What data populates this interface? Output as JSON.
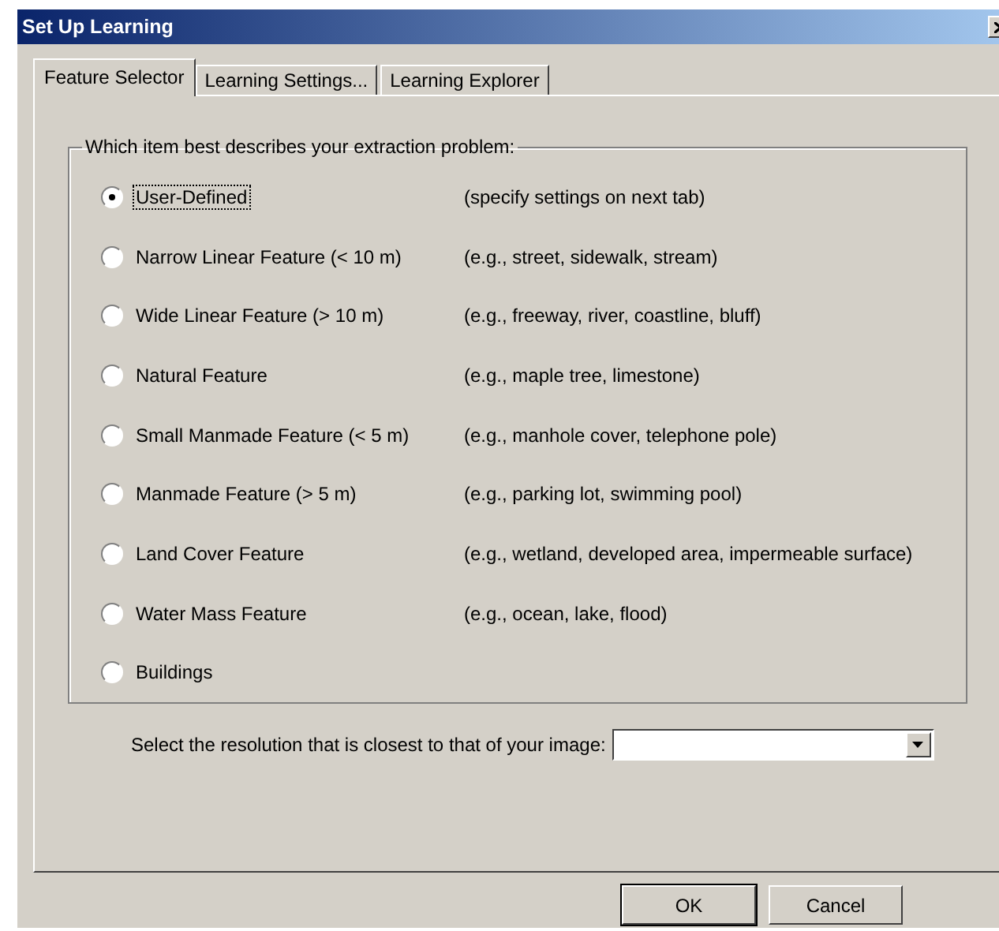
{
  "window": {
    "title": "Set Up Learning"
  },
  "tabs": [
    {
      "label": "Feature Selector",
      "selected": true
    },
    {
      "label": "Learning Settings...",
      "selected": false
    },
    {
      "label": "Learning Explorer",
      "selected": false
    }
  ],
  "group": {
    "legend": "Which item best describes your extraction problem:",
    "options": [
      {
        "label": "User-Defined",
        "hint": "(specify settings on next tab)",
        "selected": true
      },
      {
        "label": "Narrow Linear Feature (< 10 m)",
        "hint": "(e.g., street, sidewalk, stream)",
        "selected": false
      },
      {
        "label": "Wide Linear Feature (> 10 m)",
        "hint": "(e.g., freeway, river, coastline, bluff)",
        "selected": false
      },
      {
        "label": "Natural Feature",
        "hint": "(e.g., maple tree, limestone)",
        "selected": false
      },
      {
        "label": "Small Manmade Feature (< 5 m)",
        "hint": "(e.g., manhole cover, telephone pole)",
        "selected": false
      },
      {
        "label": "Manmade Feature (> 5 m)",
        "hint": "(e.g., parking lot, swimming pool)",
        "selected": false
      },
      {
        "label": "Land Cover Feature",
        "hint": "(e.g., wetland, developed area, impermeable surface)",
        "selected": false
      },
      {
        "label": "Water Mass Feature",
        "hint": "(e.g., ocean, lake, flood)",
        "selected": false
      },
      {
        "label": "Buildings",
        "selected": false
      }
    ]
  },
  "resolution": {
    "label": "Select the resolution that is closest to that of your image:"
  },
  "buttons": [
    "OK",
    "Cancel"
  ]
}
